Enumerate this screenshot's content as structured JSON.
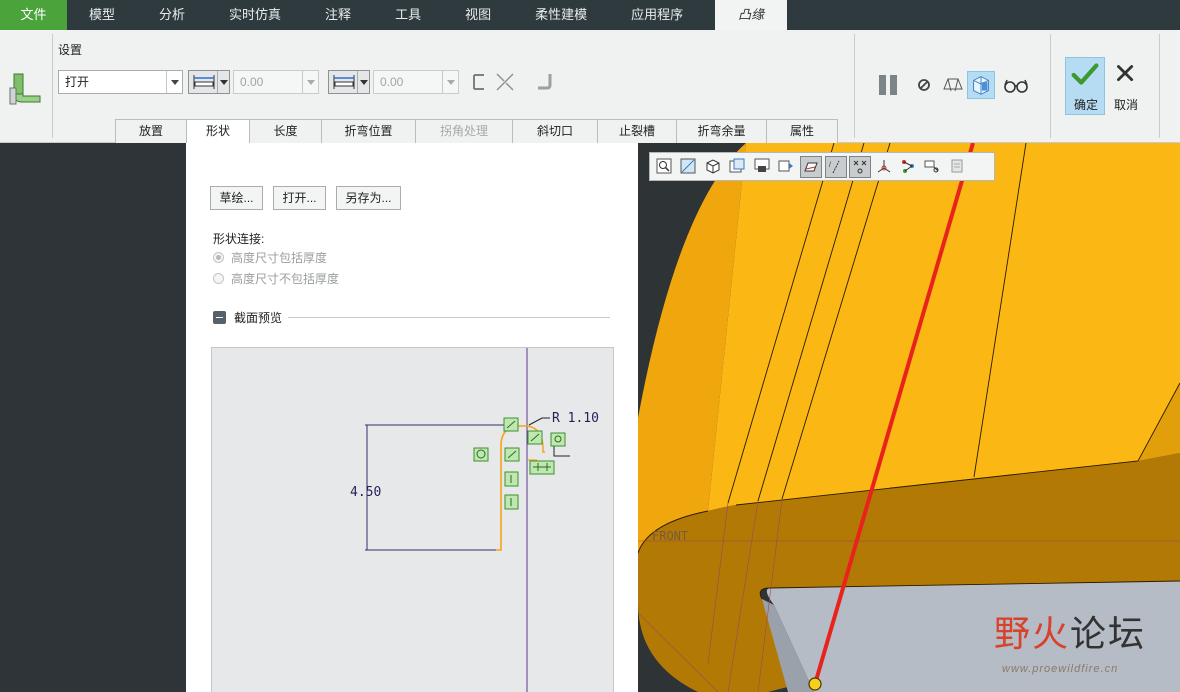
{
  "menu": {
    "tabs": [
      "文件",
      "模型",
      "分析",
      "实时仿真",
      "注释",
      "工具",
      "视图",
      "柔性建模",
      "应用程序"
    ],
    "active_tab": "凸缘"
  },
  "ribbon": {
    "settings_label": "设置",
    "shape_select": "打开",
    "dim1_value": "0.00",
    "dim2_value": "0.00",
    "subtabs": [
      "放置",
      "形状",
      "长度",
      "折弯位置",
      "拐角处理",
      "斜切口",
      "止裂槽",
      "折弯余量",
      "属性"
    ],
    "active_subtab": "形状",
    "disabled_subtab": "拐角处理",
    "confirm_label": "确定",
    "cancel_label": "取消"
  },
  "panel": {
    "buttons": [
      "草绘...",
      "打开...",
      "另存为..."
    ],
    "shape_connection_label": "形状连接:",
    "radio_options": [
      "高度尺寸包括厚度",
      "高度尺寸不包括厚度"
    ],
    "radio_selected": 0,
    "preview_label": "截面预览",
    "dim_height": "4.50",
    "dim_radius": "R 1.10"
  },
  "viewport": {
    "datum_label": "FRONT",
    "part_color": "#fbb713",
    "edge_color": "#e8231d"
  },
  "watermark": {
    "text_a": "野火",
    "text_b": "论坛",
    "url": "www.proewildfire.cn"
  },
  "colors": {
    "accent_green": "#4aa33b",
    "confirm_blue": "#b5dcf3"
  }
}
